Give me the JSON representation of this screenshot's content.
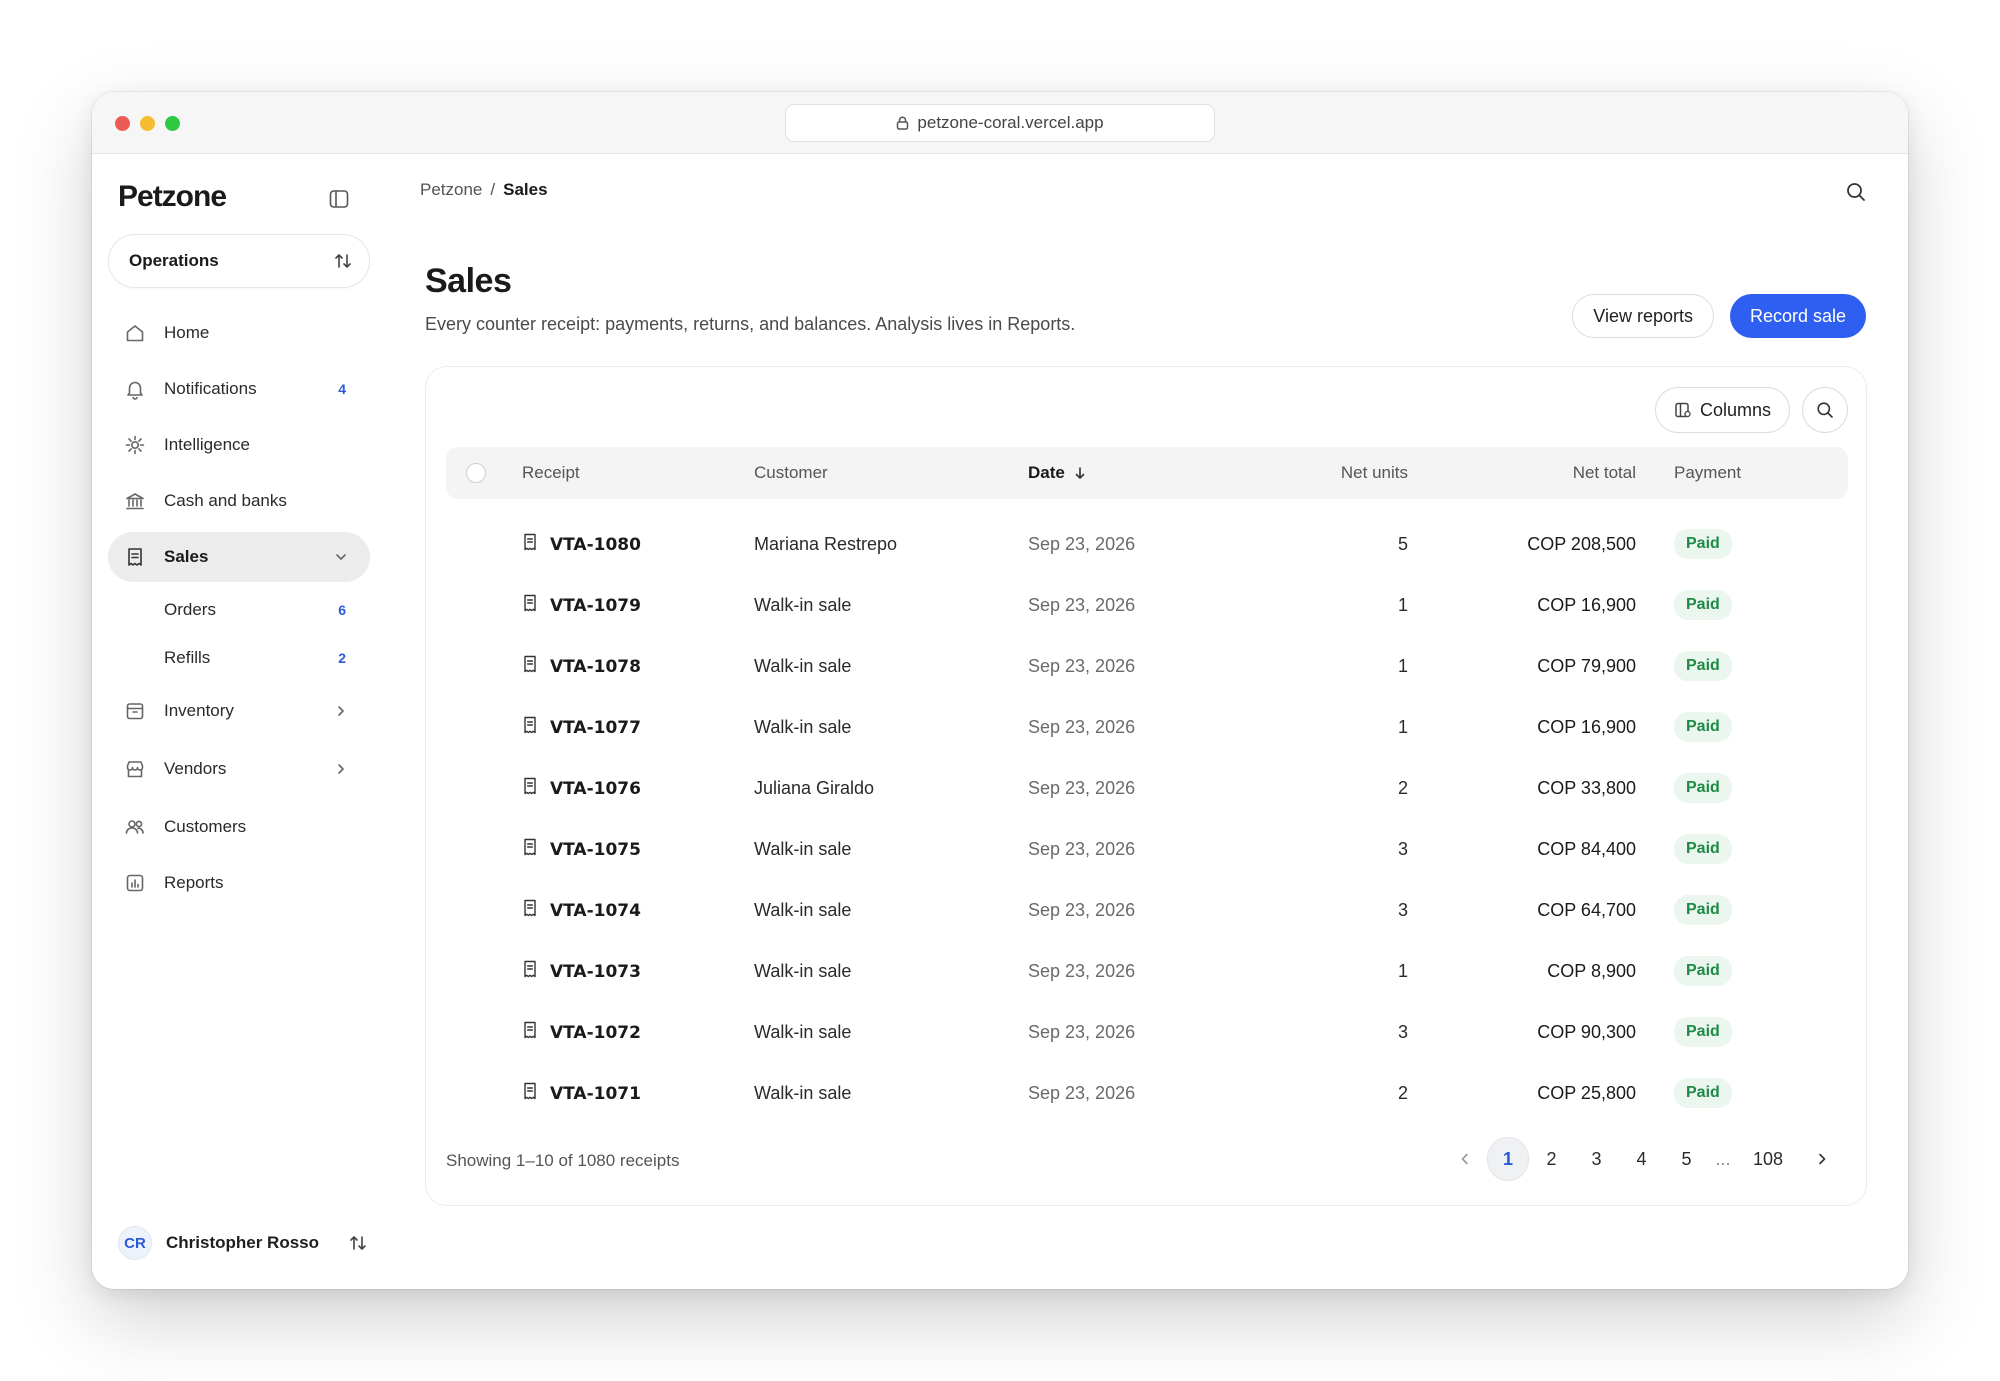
{
  "browser": {
    "url": "petzone-coral.vercel.app"
  },
  "sidebar": {
    "brand": "Petzone",
    "workspace": "Operations",
    "items": [
      {
        "label": "Home",
        "icon": "home-icon"
      },
      {
        "label": "Notifications",
        "icon": "bell-icon",
        "badge": "4"
      },
      {
        "label": "Intelligence",
        "icon": "gear-icon"
      },
      {
        "label": "Cash and banks",
        "icon": "bank-icon"
      },
      {
        "label": "Sales",
        "icon": "receipt-icon"
      },
      {
        "label": "Inventory",
        "icon": "box-icon"
      },
      {
        "label": "Vendors",
        "icon": "store-icon"
      },
      {
        "label": "Customers",
        "icon": "users-icon"
      },
      {
        "label": "Reports",
        "icon": "chart-icon"
      }
    ],
    "sub_items": [
      {
        "label": "Orders",
        "badge": "6"
      },
      {
        "label": "Refills",
        "badge": "2"
      }
    ],
    "user": {
      "initials": "CR",
      "name": "Christopher Rosso"
    }
  },
  "header": {
    "breadcrumb": [
      "Petzone",
      "/",
      "Sales"
    ]
  },
  "page": {
    "title": "Sales",
    "subtitle": "Every counter receipt: payments, returns, and balances. Analysis lives in Reports.",
    "view_reports": "View reports",
    "record_sale": "Record sale"
  },
  "table": {
    "columns_button": "Columns",
    "headers": [
      "Receipt",
      "Customer",
      "Date",
      "Net units",
      "Net total",
      "Payment"
    ],
    "rows": [
      {
        "receipt": "VTA-1080",
        "customer": "Mariana Restrepo",
        "date": "Sep 23, 2026",
        "units": "5",
        "total": "COP 208,500",
        "payment": "Paid"
      },
      {
        "receipt": "VTA-1079",
        "customer": "Walk-in sale",
        "date": "Sep 23, 2026",
        "units": "1",
        "total": "COP 16,900",
        "payment": "Paid"
      },
      {
        "receipt": "VTA-1078",
        "customer": "Walk-in sale",
        "date": "Sep 23, 2026",
        "units": "1",
        "total": "COP 79,900",
        "payment": "Paid"
      },
      {
        "receipt": "VTA-1077",
        "customer": "Walk-in sale",
        "date": "Sep 23, 2026",
        "units": "1",
        "total": "COP 16,900",
        "payment": "Paid"
      },
      {
        "receipt": "VTA-1076",
        "customer": "Juliana Giraldo",
        "date": "Sep 23, 2026",
        "units": "2",
        "total": "COP 33,800",
        "payment": "Paid"
      },
      {
        "receipt": "VTA-1075",
        "customer": "Walk-in sale",
        "date": "Sep 23, 2026",
        "units": "3",
        "total": "COP 84,400",
        "payment": "Paid"
      },
      {
        "receipt": "VTA-1074",
        "customer": "Walk-in sale",
        "date": "Sep 23, 2026",
        "units": "3",
        "total": "COP 64,700",
        "payment": "Paid"
      },
      {
        "receipt": "VTA-1073",
        "customer": "Walk-in sale",
        "date": "Sep 23, 2026",
        "units": "1",
        "total": "COP 8,900",
        "payment": "Paid"
      },
      {
        "receipt": "VTA-1072",
        "customer": "Walk-in sale",
        "date": "Sep 23, 2026",
        "units": "3",
        "total": "COP 90,300",
        "payment": "Paid"
      },
      {
        "receipt": "VTA-1071",
        "customer": "Walk-in sale",
        "date": "Sep 23, 2026",
        "units": "2",
        "total": "COP 25,800",
        "payment": "Paid"
      }
    ],
    "footer": "Showing 1–10 of 1080 receipts",
    "pages": [
      "1",
      "2",
      "3",
      "4",
      "5",
      "...",
      "108"
    ]
  },
  "colors": {
    "accent": "#2f5ff0",
    "paid_bg": "#eaf6ee",
    "paid_text": "#1f8a46"
  }
}
